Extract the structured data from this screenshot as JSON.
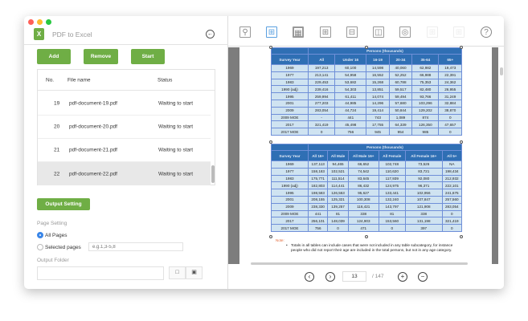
{
  "window": {
    "controls": {
      "close": "#ff5f57",
      "minimize": "#febc2e",
      "maximize": "#28c840"
    }
  },
  "app": {
    "title": "PDF to Excel",
    "logo": "X",
    "accent": "#6fae45"
  },
  "buttons": {
    "add": "Add",
    "remove": "Remove",
    "start": "Start",
    "output_setting": "Output Setting"
  },
  "file_list": {
    "headers": [
      "No.",
      "File name",
      "Status"
    ],
    "rows": [
      {
        "no": "19",
        "name": "pdf-document-19.pdf",
        "status": "Waiting to start"
      },
      {
        "no": "20",
        "name": "pdf-document-20.pdf",
        "status": "Waiting to start"
      },
      {
        "no": "21",
        "name": "pdf-document-21.pdf",
        "status": "Waiting to start"
      },
      {
        "no": "22",
        "name": "pdf-document-22.pdf",
        "status": "Waiting to start",
        "selected": true
      }
    ]
  },
  "settings": {
    "page_setting_label": "Page Setting",
    "all_pages": "All Pages",
    "selected_pages": "Selected pages",
    "selected_pages_placeholder": "e.g.1,3-5,8",
    "selected_option": "All Pages",
    "output_folder_label": "Output Folder",
    "output_folder_value": ""
  },
  "toolbar": {
    "icons": [
      "search",
      "select-table",
      "image-area",
      "table-add",
      "table-split-rows",
      "table-split-cols",
      "ocr",
      "disabled-table-1",
      "disabled-table-2",
      "help"
    ]
  },
  "document": {
    "table1": {
      "group_header": "Persons (thousands)",
      "headers": [
        "Survey Year",
        "All",
        "Under 16",
        "16-19",
        "20-34",
        "35-64",
        "65+"
      ],
      "rows": [
        [
          "1969",
          "197,213",
          "60,100",
          "14,598",
          "40,060",
          "62,982",
          "19,473"
        ],
        [
          "1977",
          "213,141",
          "54,958",
          "16,552",
          "52,252",
          "66,988",
          "22,391"
        ],
        [
          "1983",
          "229,453",
          "53,682",
          "15,268",
          "60,788",
          "75,353",
          "24,362"
        ],
        [
          "1990 (adj)",
          "239,416",
          "54,303",
          "13,851",
          "59,517",
          "82,480",
          "26,955"
        ],
        [
          "1995",
          "259,994",
          "61,411",
          "14,074",
          "59,494",
          "93,766",
          "31,249"
        ],
        [
          "2001",
          "277,203",
          "44,985",
          "14,296",
          "57,680",
          "103,296",
          "32,884"
        ],
        [
          "2009",
          "283,054",
          "44,724",
          "19,414",
          "50,844",
          "129,202",
          "38,870"
        ],
        [
          "2009 MOE",
          "-",
          "441",
          "743",
          "1,089",
          "874",
          "0"
        ],
        [
          "2017",
          "321,419",
          "45,498",
          "17,755",
          "64,339",
          "126,350",
          "47,657"
        ],
        [
          "2017 MOE",
          "0",
          "756",
          "945",
          "954",
          "985",
          "0"
        ]
      ]
    },
    "table2": {
      "group_header": "Persons (thousands)",
      "headers": [
        "Survey Year",
        "All 16+",
        "All Male",
        "All Male 16+",
        "All Female",
        "All Female 16+",
        "All 5+"
      ],
      "rows": [
        [
          "1969",
          "137,113",
          "94,465",
          "66,652",
          "102,748",
          "73,526",
          "NA"
        ],
        [
          "1977",
          "158,183",
          "102,521",
          "74,542",
          "110,620",
          "83,721",
          "198,434"
        ],
        [
          "1983",
          "175,771",
          "111,514",
          "83,645",
          "117,939",
          "92,080",
          "212,932"
        ],
        [
          "1990 (adj)",
          "182,803",
          "114,441",
          "86,432",
          "124,975",
          "96,371",
          "222,101"
        ],
        [
          "1995",
          "198,583",
          "126,553",
          "95,627",
          "133,441",
          "102,956",
          "241,675"
        ],
        [
          "2001",
          "208,155",
          "125,321",
          "100,308",
          "132,240",
          "107,847",
          "257,560"
        ],
        [
          "2009",
          "238,330",
          "139,257",
          "116,421",
          "143,797",
          "121,908",
          "283,054"
        ],
        [
          "2009 MOE",
          "441",
          "81",
          "338",
          "81",
          "338",
          "0"
        ],
        [
          "2017",
          "256,101",
          "148,039",
          "124,903",
          "153,560",
          "131,198",
          "321,419"
        ],
        [
          "2017 MOE",
          "756",
          "0",
          "471",
          "0",
          "397",
          "0"
        ]
      ]
    },
    "note_label": "Note:",
    "note_text": "Totals in all tables can include cases that were not included in any table subcategory, for instance people who did not report their age are included in the total persons, but not in any age category."
  },
  "pagination": {
    "current_page": "13",
    "total": "/ 147"
  }
}
